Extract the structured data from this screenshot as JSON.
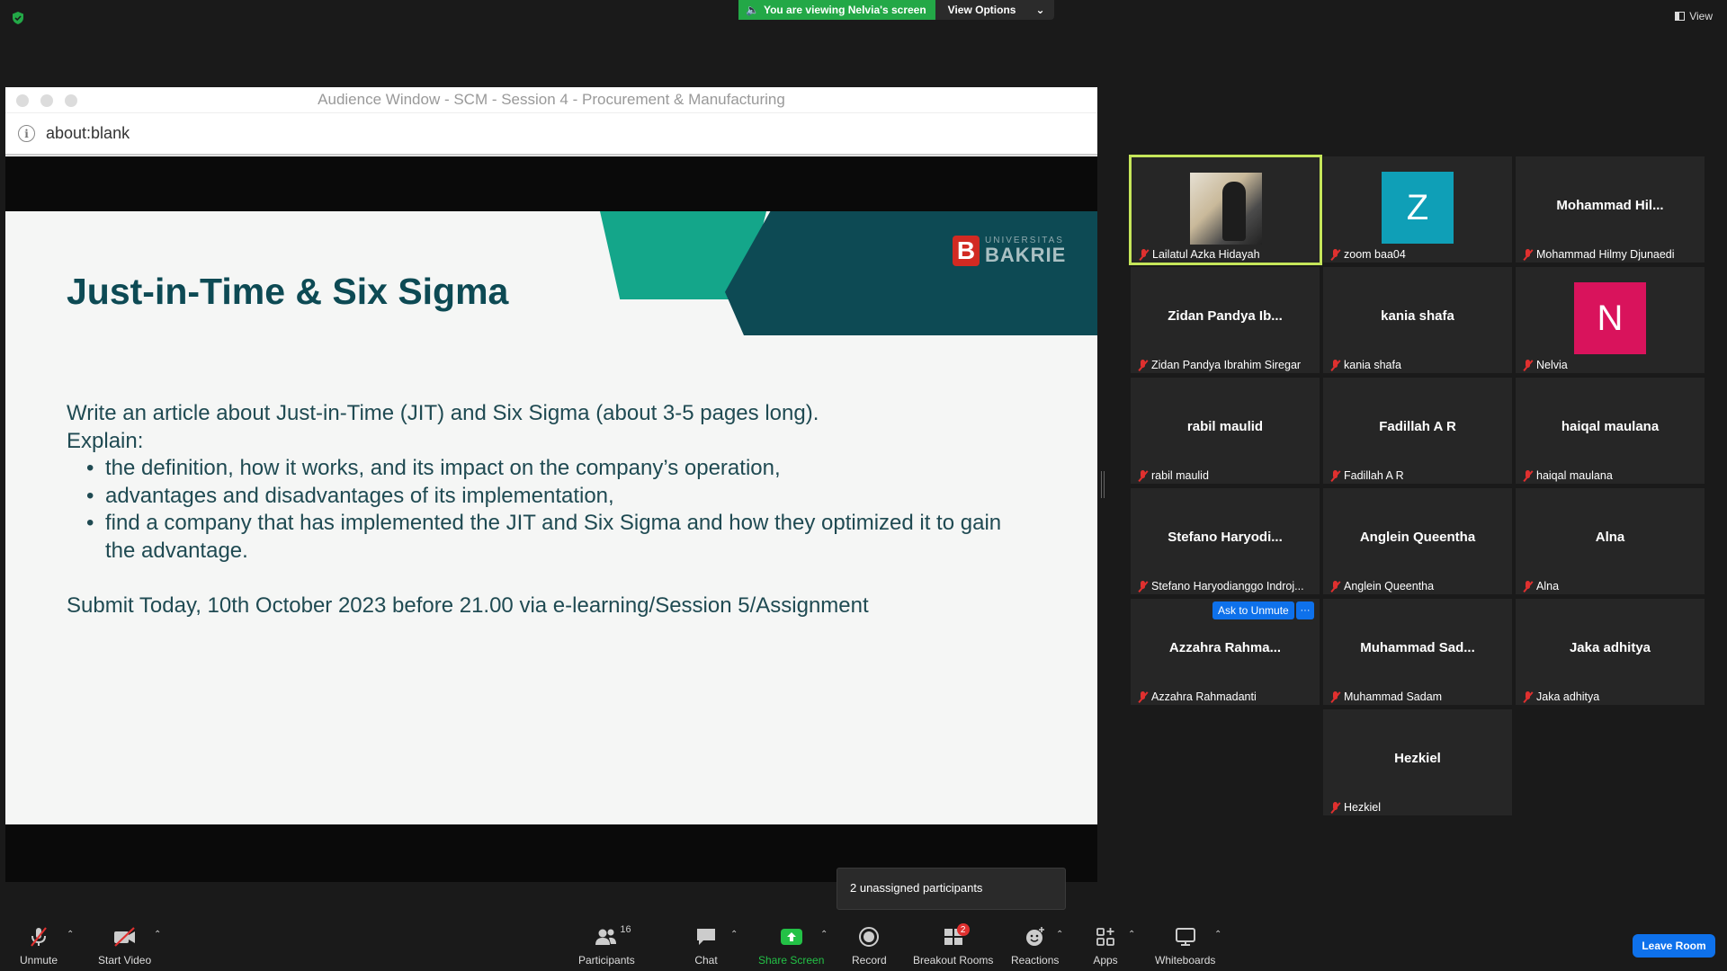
{
  "top": {
    "viewing_text": "You are viewing Nelvia's screen",
    "view_options": "View Options",
    "view": "View"
  },
  "window": {
    "title": "Audience Window - SCM - Session 4 - Procurement & Manufacturing",
    "url": "about:blank"
  },
  "slide": {
    "title": "Just-in-Time & Six Sigma",
    "logo_top": "UNIVERSITAS",
    "logo_bottom": "BAKRIE",
    "line1": "Write an article about Just-in-Time (JIT) and Six Sigma (about 3-5 pages long).",
    "line2": "Explain:",
    "bullets": [
      "the definition, how it works, and its impact on the company’s operation,",
      "advantages and disadvantages of its implementation,",
      "find a company that has implemented the JIT and Six Sigma and how they optimized it to gain the advantage."
    ],
    "submit": "Submit Today, 10th October 2023 before 21.00 via e-learning/Session 5/Assignment"
  },
  "participants": [
    {
      "big": "",
      "caption": "Lailatul Azka Hidayah"
    },
    {
      "big": "Z",
      "caption": "zoom baa04"
    },
    {
      "big": "Mohammad  Hil...",
      "caption": "Mohammad Hilmy Djunaedi"
    },
    {
      "big": "Zidan  Pandya  Ib...",
      "caption": "Zidan Pandya Ibrahim Siregar"
    },
    {
      "big": "kania shafa",
      "caption": "kania shafa"
    },
    {
      "big": "N",
      "caption": "Nelvia"
    },
    {
      "big": "rabil maulid",
      "caption": "rabil maulid"
    },
    {
      "big": "Fadillah A R",
      "caption": "Fadillah A R"
    },
    {
      "big": "haiqal maulana",
      "caption": "haiqal maulana"
    },
    {
      "big": "Stefano  Haryodi...",
      "caption": "Stefano Haryodianggo Indroj..."
    },
    {
      "big": "Anglein Queentha",
      "caption": "Anglein Queentha"
    },
    {
      "big": "Alna",
      "caption": "Alna"
    },
    {
      "big": "Azzahra  Rahma...",
      "caption": "Azzahra Rahmadanti"
    },
    {
      "big": "Muhammad  Sad...",
      "caption": "Muhammad Sadam"
    },
    {
      "big": "Jaka adhitya",
      "caption": "Jaka adhitya"
    },
    {
      "big": "Hezkiel",
      "caption": "Hezkiel"
    }
  ],
  "ask_unmute": "Ask to Unmute",
  "ask_more": "···",
  "tooltip": "2 unassigned participants",
  "toolbar": {
    "unmute": "Unmute",
    "start_video": "Start Video",
    "participants": "Participants",
    "participants_count": "16",
    "chat": "Chat",
    "share_screen": "Share Screen",
    "record": "Record",
    "breakout": "Breakout Rooms",
    "breakout_badge": "2",
    "reactions": "Reactions",
    "apps": "Apps",
    "whiteboards": "Whiteboards",
    "leave": "Leave Room"
  },
  "colors": {
    "accent_blue": "#0e71eb",
    "viewing_green": "#23a847",
    "active_speaker": "#c6e65a",
    "avatar_z": "#0f9fb7",
    "avatar_n": "#d9135c"
  }
}
